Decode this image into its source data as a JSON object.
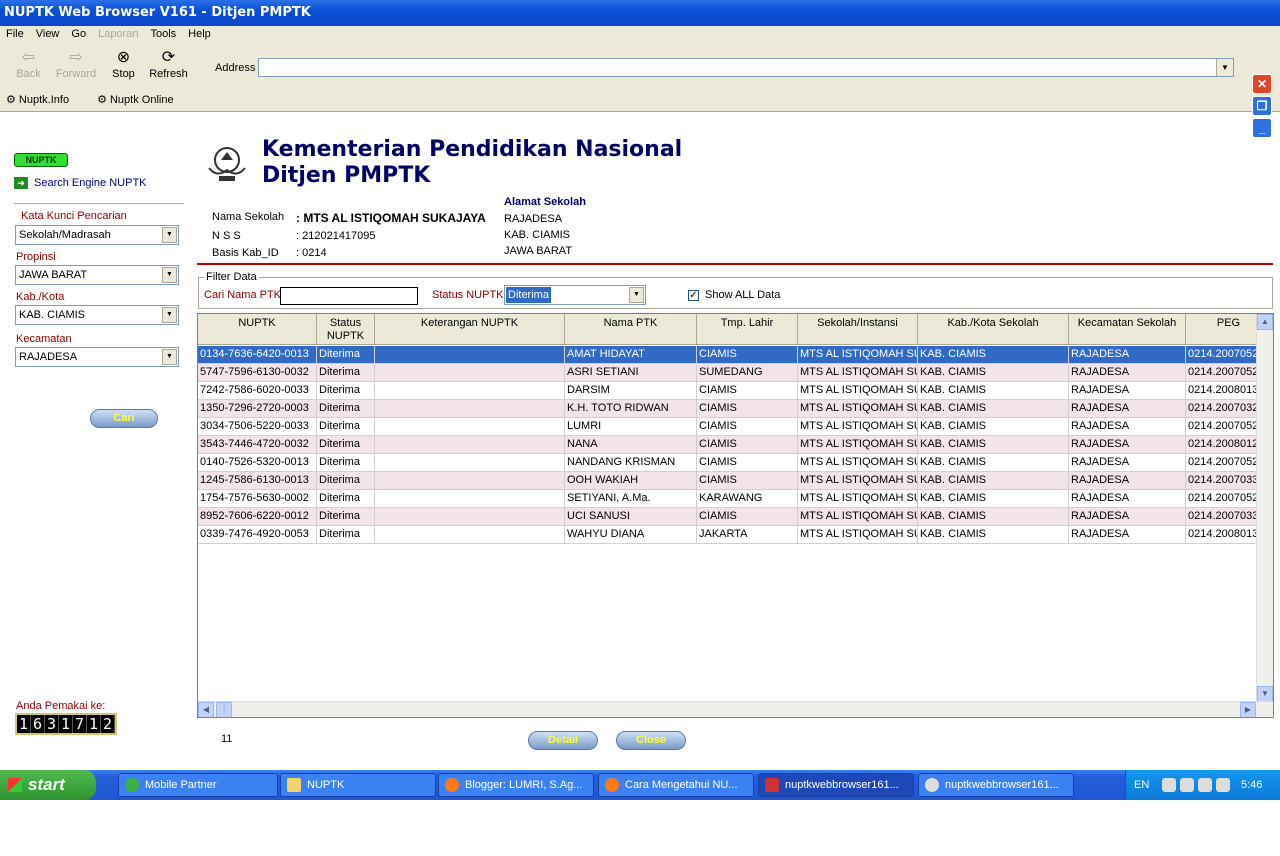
{
  "window": {
    "title": "NUPTK Web Browser V161      - Ditjen PMPTK"
  },
  "menu": [
    {
      "label": "File",
      "disabled": false
    },
    {
      "label": "View",
      "disabled": false
    },
    {
      "label": "Go",
      "disabled": false
    },
    {
      "label": "Laporan",
      "disabled": true
    },
    {
      "label": "Tools",
      "disabled": false
    },
    {
      "label": "Help",
      "disabled": false
    }
  ],
  "toolbar": {
    "back": "Back",
    "forward": "Forward",
    "stop": "Stop",
    "refresh": "Refresh",
    "address_label": "Address",
    "address_value": ""
  },
  "links": {
    "nuptk_info": "Nuptk.Info",
    "nuptk_online": "Nuptk Online"
  },
  "left": {
    "logo": "NUPTK",
    "search_engine": "Search Engine NUPTK",
    "kata_kunci_label": "Kata Kunci Pencarian",
    "kata_kunci_value": "Sekolah/Madrasah",
    "propinsi_label": "Propinsi",
    "propinsi_value": "JAWA BARAT",
    "kabkota_label": "Kab./Kota",
    "kabkota_value": "KAB. CIAMIS",
    "kecamatan_label": "Kecamatan",
    "kecamatan_value": "RAJADESA",
    "cari": "Cari",
    "pemakai_label": "Anda Pemakai ke:",
    "counter": [
      "1",
      "6",
      "3",
      "1",
      "7",
      "1",
      "2"
    ]
  },
  "header": {
    "title1": "Kementerian Pendidikan Nasional",
    "title2": "Ditjen PMPTK"
  },
  "school": {
    "nama_label": "Nama Sekolah",
    "nama_value": ": MTS AL ISTIQOMAH SUKAJAYA",
    "nss_label": "N S S",
    "nss_value": ": 212021417095",
    "basis_label": "Basis Kab_ID",
    "basis_value": ": 0214",
    "alamat_title": "Alamat Sekolah",
    "alamat1": "RAJADESA",
    "alamat2": "KAB. CIAMIS",
    "alamat3": "JAWA BARAT"
  },
  "filter": {
    "legend": "Filter Data",
    "cari_nama_label": "Cari Nama PTK",
    "status_label": "Status NUPTK",
    "status_value": "Diterima",
    "show_all_label": "Show ALL Data",
    "show_all_checked": true
  },
  "grid": {
    "columns": [
      "NUPTK",
      "Status\nNUPTK",
      "Keterangan NUPTK",
      "Nama PTK",
      "Tmp. Lahir",
      "Sekolah/Instansi",
      "Kab./Kota Sekolah",
      "Kecamatan Sekolah",
      "PEG"
    ],
    "rows": [
      [
        "0134-7636-6420-0013",
        "Diterima",
        "",
        "AMAT HIDAYAT",
        "CIAMIS",
        "MTS AL ISTIQOMAH SUK",
        "KAB. CIAMIS",
        "RAJADESA",
        "0214.2007052"
      ],
      [
        "5747-7596-6130-0032",
        "Diterima",
        "",
        "ASRI SETIANI",
        "SUMEDANG",
        "MTS AL ISTIQOMAH SUK",
        "KAB. CIAMIS",
        "RAJADESA",
        "0214.2007052"
      ],
      [
        "7242-7586-6020-0033",
        "Diterima",
        "",
        "DARSIM",
        "CIAMIS",
        "MTS AL ISTIQOMAH SUK",
        "KAB. CIAMIS",
        "RAJADESA",
        "0214.2008013"
      ],
      [
        "1350-7296-2720-0003",
        "Diterima",
        "",
        "K.H. TOTO RIDWAN",
        "CIAMIS",
        "MTS AL ISTIQOMAH SUK",
        "KAB. CIAMIS",
        "RAJADESA",
        "0214.2007032"
      ],
      [
        "3034-7506-5220-0033",
        "Diterima",
        "",
        "LUMRI",
        "CIAMIS",
        "MTS AL ISTIQOMAH SUK",
        "KAB. CIAMIS",
        "RAJADESA",
        "0214.2007052"
      ],
      [
        "3543-7446-4720-0032",
        "Diterima",
        "",
        "NANA",
        "CIAMIS",
        "MTS AL ISTIQOMAH SUK",
        "KAB. CIAMIS",
        "RAJADESA",
        "0214.2008012"
      ],
      [
        "0140-7526-5320-0013",
        "Diterima",
        "",
        "NANDANG KRISMAN",
        "CIAMIS",
        "MTS AL ISTIQOMAH SUK",
        "KAB. CIAMIS",
        "RAJADESA",
        "0214.2007052"
      ],
      [
        "1245-7586-6130-0013",
        "Diterima",
        "",
        "OOH WAKIAH",
        "CIAMIS",
        "MTS AL ISTIQOMAH SUK",
        "KAB. CIAMIS",
        "RAJADESA",
        "0214.2007033"
      ],
      [
        "1754-7576-5630-0002",
        "Diterima",
        "",
        "SETIYANI, A.Ma.",
        "KARAWANG",
        "MTS AL ISTIQOMAH SUK",
        "KAB. CIAMIS",
        "RAJADESA",
        "0214.2007052"
      ],
      [
        "8952-7606-6220-0012",
        "Diterima",
        "",
        "UCI SANUSI",
        "CIAMIS",
        "MTS AL ISTIQOMAH SUK",
        "KAB. CIAMIS",
        "RAJADESA",
        "0214.2007033"
      ],
      [
        "0339-7476-4920-0053",
        "Diterima",
        "",
        "WAHYU DIANA",
        "JAKARTA",
        "MTS AL ISTIQOMAH SUK",
        "KAB. CIAMIS",
        "RAJADESA",
        "0214.2008013"
      ]
    ]
  },
  "footer": {
    "count": "11",
    "detail": "Detail",
    "close": "Close"
  },
  "taskbar": {
    "start": "start",
    "tasks": [
      "Mobile Partner",
      "NUPTK",
      "Blogger: LUMRI, S.Ag...",
      "Cara Mengetahui NU...",
      "nuptkwebbrowser161...",
      "nuptkwebbrowser161..."
    ],
    "lang": "EN",
    "clock": "5:46"
  }
}
